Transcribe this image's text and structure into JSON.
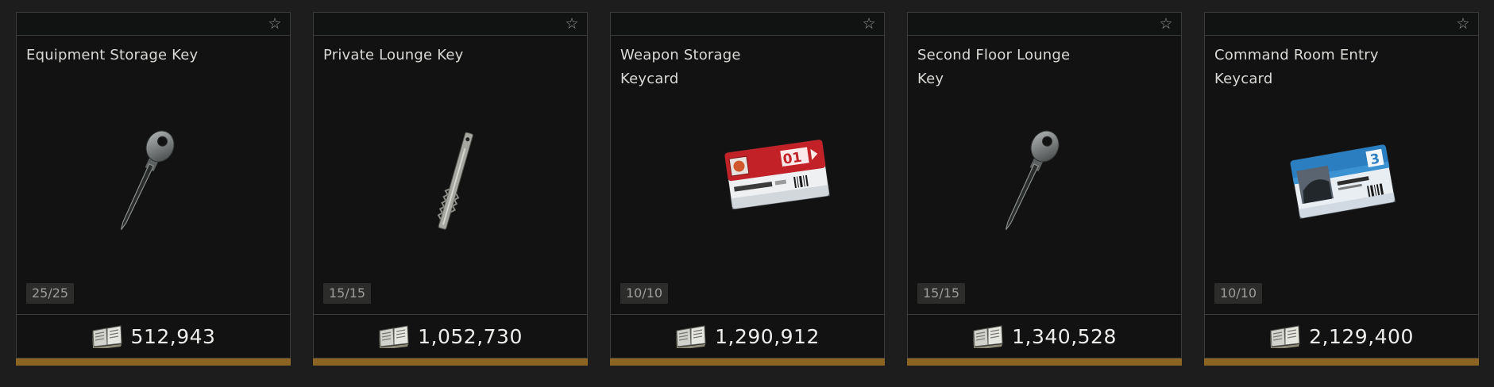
{
  "favorite_icon": "star-outline-icon",
  "currency_icon": "handbook-currency-icon",
  "rarity_color": "#8c6523",
  "cards": [
    {
      "title": "Equipment Storage Key",
      "stock": "25/25",
      "price": "512,943",
      "item_icon": "metal-key-icon"
    },
    {
      "title": "Private Lounge Key",
      "stock": "15/15",
      "price": "1,052,730",
      "item_icon": "flat-skeleton-key-icon"
    },
    {
      "title": "Weapon Storage Keycard",
      "stock": "10/10",
      "price": "1,290,912",
      "item_icon": "red-keycard-01-icon",
      "card_badge": "01"
    },
    {
      "title": "Second Floor Lounge Key",
      "stock": "15/15",
      "price": "1,340,528",
      "item_icon": "metal-key-icon"
    },
    {
      "title": "Command Room Entry Keycard",
      "stock": "10/10",
      "price": "2,129,400",
      "item_icon": "blue-keycard-3-icon",
      "card_badge": "3"
    }
  ]
}
